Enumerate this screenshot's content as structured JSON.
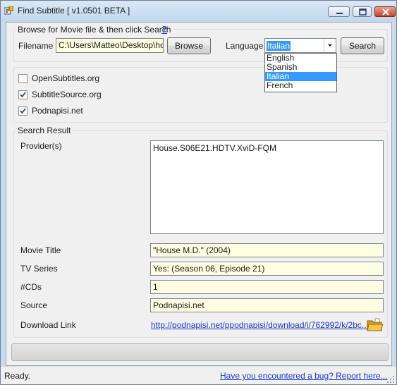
{
  "window": {
    "title": "Find Subtitle [ v1.0501 BETA ]",
    "controls": [
      "minimize",
      "maximize",
      "close"
    ]
  },
  "browse_group": {
    "legend": "Browse for Movie file & then click Search",
    "help": "?",
    "filename_label": "Filename",
    "filename_value": "C:\\Users\\Matteo\\Desktop\\house",
    "browse_label": "Browse",
    "language_label": "Language",
    "language_selected": "Italian",
    "language_options": [
      "English",
      "Spanish",
      "Italian",
      "French"
    ],
    "search_label": "Search"
  },
  "providers": [
    {
      "label": "OpenSubtitles.org",
      "checked": false
    },
    {
      "label": "SubtitleSource.org",
      "checked": true
    },
    {
      "label": "Podnapisi.net",
      "checked": true
    }
  ],
  "results": {
    "legend": "Search Result",
    "providers_label": "Provider(s)",
    "providers_list": [
      "House.S06E21.HDTV.XviD-FQM"
    ],
    "movie_title_label": "Movie Title",
    "movie_title_value": "\"House M.D.\" (2004)",
    "tv_series_label": "TV Series",
    "tv_series_value": "Yes: (Season 06, Episode 21)",
    "cds_label": "#CDs",
    "cds_value": "1",
    "source_label": "Source",
    "source_value": "Podnapisi.net",
    "download_label": "Download Link",
    "download_value": "http://podnapisi.net/ppodnapisi/download/i/762992/k/2bc...",
    "folder_icon": "open-folder-icon"
  },
  "progress": {
    "value": 0
  },
  "status": {
    "text": "Ready.",
    "report_link": "Have you encountered a bug? Report here..."
  },
  "colors": {
    "readonly_field": "#fefee0",
    "link": "#1a3cc8",
    "selection": "#3399ff"
  }
}
